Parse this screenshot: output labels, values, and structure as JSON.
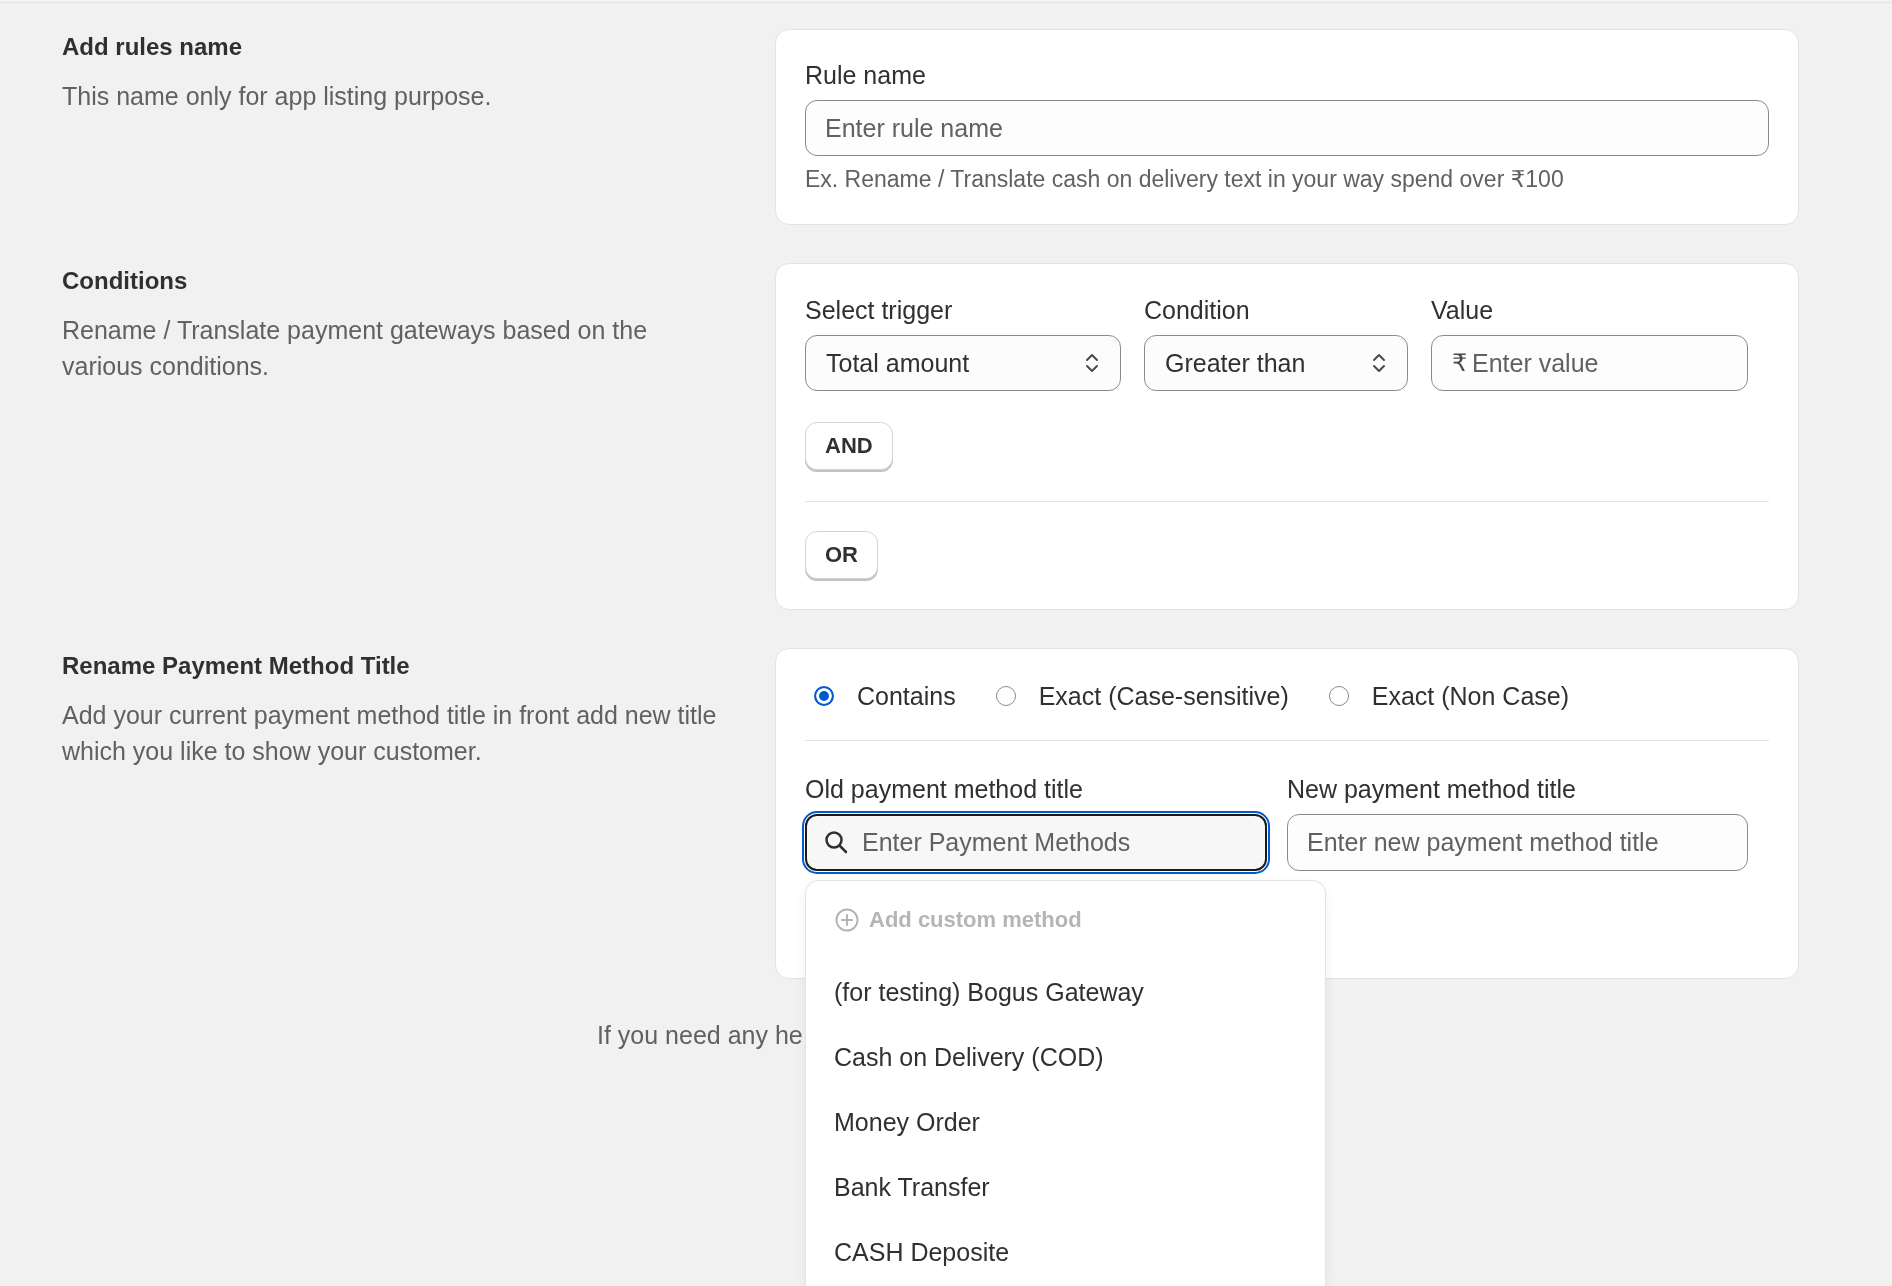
{
  "rule_name_section": {
    "title": "Add rules name",
    "description": "This name only for app listing purpose.",
    "field": {
      "label": "Rule name",
      "placeholder": "Enter rule name",
      "hint": "Ex. Rename / Translate cash on delivery text in your way spend over ₹100"
    }
  },
  "conditions_section": {
    "title": "Conditions",
    "description": "Rename / Translate payment gateways based on the various conditions.",
    "fields": [
      {
        "kind": "select",
        "label": "Select trigger",
        "value": "Total amount"
      },
      {
        "kind": "select",
        "label": "Condition",
        "value": "Greater than"
      },
      {
        "kind": "text",
        "label": "Value",
        "prefix": "₹",
        "placeholder": "Enter value"
      }
    ],
    "and_button": {
      "label": "AND"
    },
    "or_button": {
      "label": "OR"
    }
  },
  "rename_section": {
    "title": "Rename Payment Method Title",
    "description": "Add your current payment method title in front add new title which you like to show your customer.",
    "match_options": [
      {
        "label": "Contains",
        "selected": true
      },
      {
        "label": "Exact (Case-sensitive)",
        "selected": false
      },
      {
        "label": "Exact (Non Case)",
        "selected": false
      }
    ],
    "old_title": {
      "label": "Old payment method title",
      "placeholder": "Enter Payment Methods",
      "focused": true
    },
    "new_title": {
      "label": "New payment method title",
      "placeholder": "Enter new payment method title"
    },
    "dropdown": {
      "add_custom": {
        "label": "Add custom method",
        "disabled": true
      },
      "options": [
        "(for testing) Bogus Gateway",
        "Cash on Delivery (COD)",
        "Money Order",
        "Bank Transfer",
        "CASH Deposite"
      ]
    }
  },
  "footer": {
    "text": "If you need any he"
  }
}
